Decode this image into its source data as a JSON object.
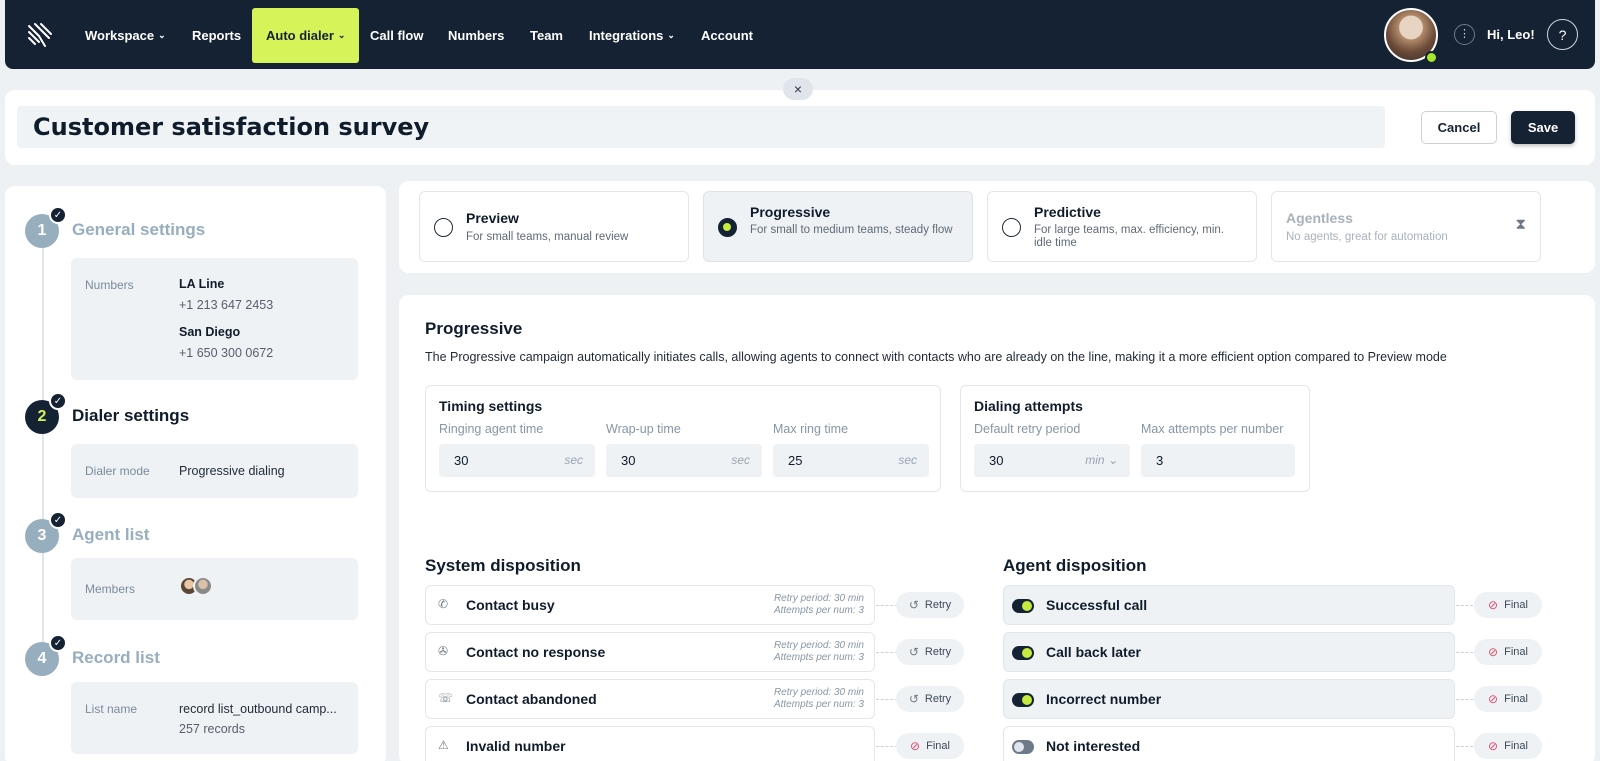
{
  "nav": {
    "items": [
      {
        "label": "Workspace",
        "dropdown": true
      },
      {
        "label": "Reports",
        "dropdown": false
      },
      {
        "label": "Auto dialer",
        "dropdown": true,
        "active": true
      },
      {
        "label": "Call flow",
        "dropdown": false
      },
      {
        "label": "Numbers",
        "dropdown": false
      },
      {
        "label": "Team",
        "dropdown": false
      },
      {
        "label": "Integrations",
        "dropdown": true
      },
      {
        "label": "Account",
        "dropdown": false
      }
    ],
    "greeting": "Hi, Leo!",
    "help_icon": "?",
    "more_icon": "⋮",
    "accent_color": "#d6f35a",
    "nav_bg": "#152233"
  },
  "header": {
    "campaign_name": "Customer satisfaction survey",
    "cancel_label": "Cancel",
    "save_label": "Save",
    "close_icon": "×"
  },
  "steps": [
    {
      "num": "1",
      "title": "General settings",
      "completed": true,
      "label": "Numbers",
      "numbers": [
        {
          "name": "LA Line",
          "phone": "+1 213 647 2453"
        },
        {
          "name": "San Diego",
          "phone": "+1 650 300 0672"
        }
      ]
    },
    {
      "num": "2",
      "title": "Dialer settings",
      "completed": true,
      "current": true,
      "label": "Dialer mode",
      "value": "Progressive dialing"
    },
    {
      "num": "3",
      "title": "Agent list",
      "completed": true,
      "label": "Members"
    },
    {
      "num": "4",
      "title": "Record list",
      "completed": true,
      "label": "List name",
      "value": "record list_outbound camp...",
      "sub": "257 records"
    }
  ],
  "modes": [
    {
      "title": "Preview",
      "desc": "For small teams, manual review",
      "selected": false
    },
    {
      "title": "Progressive",
      "desc": "For small to medium teams, steady flow",
      "selected": true
    },
    {
      "title": "Predictive",
      "desc": "For large teams, max. efficiency, min. idle time",
      "selected": false
    },
    {
      "title": "Agentless",
      "desc": "No agents, great for automation",
      "disabled": true
    }
  ],
  "main": {
    "title": "Progressive",
    "desc": "The Progressive campaign automatically initiates calls, allowing agents to connect with contacts who are already on the line, making it a more efficient option compared to Preview mode",
    "timing": {
      "title": "Timing settings",
      "fields": [
        {
          "label": "Ringing agent time",
          "value": "30",
          "unit": "sec"
        },
        {
          "label": "Wrap-up time",
          "value": "30",
          "unit": "sec"
        },
        {
          "label": "Max ring time",
          "value": "25",
          "unit": "sec"
        }
      ]
    },
    "attempts": {
      "title": "Dialing attempts",
      "fields": [
        {
          "label": "Default retry period",
          "value": "30",
          "unit": "min ⌄"
        },
        {
          "label": "Max attempts per number",
          "value": "3",
          "unit": ""
        }
      ]
    }
  },
  "system_disposition": {
    "title": "System disposition",
    "rows": [
      {
        "label": "Contact busy",
        "meta1": "Retry period: 30 min",
        "meta2": "Attempts per num: 3",
        "tag": "Retry"
      },
      {
        "label": "Contact no response",
        "meta1": "Retry period: 30 min",
        "meta2": "Attempts per num: 3",
        "tag": "Retry"
      },
      {
        "label": "Contact abandoned",
        "meta1": "Retry period: 30 min",
        "meta2": "Attempts per num: 3",
        "tag": "Retry"
      },
      {
        "label": "Invalid number",
        "meta1": "",
        "meta2": "",
        "tag": "Final"
      }
    ]
  },
  "agent_disposition": {
    "title": "Agent disposition",
    "rows": [
      {
        "label": "Successful call",
        "enabled": true,
        "tag": "Final"
      },
      {
        "label": "Call back later",
        "enabled": true,
        "tag": "Final"
      },
      {
        "label": "Incorrect number",
        "enabled": true,
        "tag": "Final"
      },
      {
        "label": "Not interested",
        "enabled": false,
        "tag": "Final"
      }
    ]
  }
}
